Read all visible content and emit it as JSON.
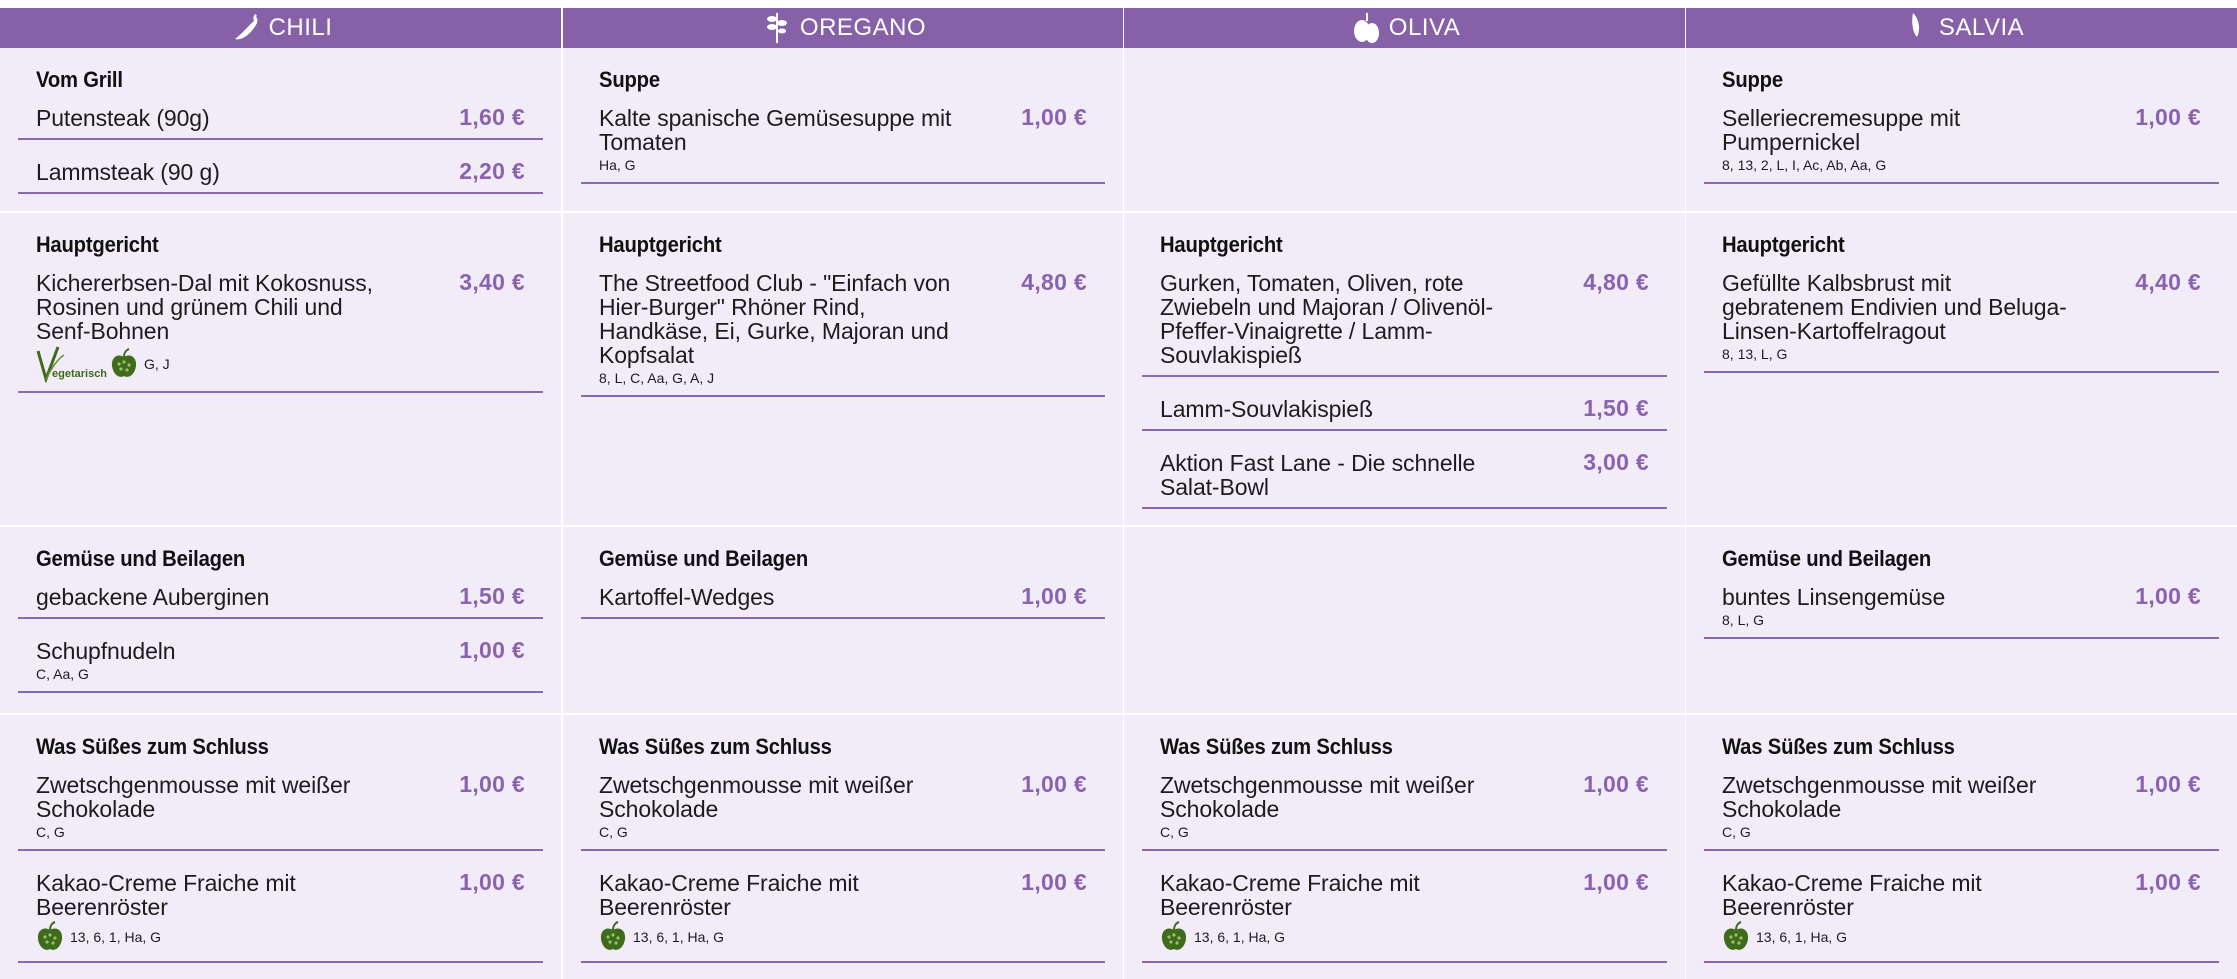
{
  "columns": [
    {
      "name": "CHILI",
      "icon": "chili-icon",
      "sections": [
        {
          "category": "Vom Grill",
          "items": [
            {
              "name": "Putensteak (90g)",
              "price": "1,60 €",
              "allergens": ""
            },
            {
              "name": "Lammsteak (90 g)",
              "price": "2,20 €",
              "allergens": ""
            }
          ]
        },
        {
          "category": "Hauptgericht",
          "items": [
            {
              "name": "Kichererbsen-Dal mit Kokosnuss, Rosinen und grünem Chili und Senf-Bohnen",
              "price": "3,40 €",
              "allergens": "G, J",
              "veg_label": "vegetarisch",
              "apple": true
            }
          ]
        },
        {
          "category": "Gemüse und Beilagen",
          "items": [
            {
              "name": "gebackene Auberginen",
              "price": "1,50 €",
              "allergens": ""
            },
            {
              "name": "Schupfnudeln",
              "price": "1,00 €",
              "allergens": "C, Aa, G"
            }
          ]
        },
        {
          "category": "Was Süßes zum Schluss",
          "items": [
            {
              "name": "Zwetschgenmousse mit weißer Schokolade",
              "price": "1,00 €",
              "allergens": "C, G"
            },
            {
              "name": "Kakao-Creme Fraiche mit Beerenröster",
              "price": "1,00 €",
              "allergens": "13, 6, 1, Ha, G",
              "apple": true
            }
          ]
        }
      ]
    },
    {
      "name": "OREGANO",
      "icon": "oregano-icon",
      "sections": [
        {
          "category": "Suppe",
          "items": [
            {
              "name": "Kalte spanische Gemüsesuppe mit Tomaten",
              "price": "1,00 €",
              "allergens": "Ha, G"
            }
          ]
        },
        {
          "category": "Hauptgericht",
          "items": [
            {
              "name": "The Streetfood Club - \"Einfach von Hier-Burger\" Rhöner Rind, Handkäse, Ei, Gurke, Majoran und Kopfsalat",
              "price": "4,80 €",
              "allergens": "8, L, C, Aa, G, A, J"
            }
          ]
        },
        {
          "category": "Gemüse und Beilagen",
          "items": [
            {
              "name": "Kartoffel-Wedges",
              "price": "1,00 €",
              "allergens": ""
            }
          ]
        },
        {
          "category": "Was Süßes zum Schluss",
          "items": [
            {
              "name": "Zwetschgenmousse mit weißer Schokolade",
              "price": "1,00 €",
              "allergens": "C, G"
            },
            {
              "name": "Kakao-Creme Fraiche mit Beerenröster",
              "price": "1,00 €",
              "allergens": "13, 6, 1, Ha, G",
              "apple": true
            }
          ]
        }
      ]
    },
    {
      "name": "OLIVA",
      "icon": "olive-icon",
      "sections": [
        {
          "category": "",
          "items": []
        },
        {
          "category": "Hauptgericht",
          "items": [
            {
              "name": "Gurken, Tomaten, Oliven, rote Zwiebeln und Majoran / Olivenöl-Pfeffer-Vinaigrette / Lamm-Souvlakispieß",
              "price": "4,80 €",
              "allergens": ""
            },
            {
              "name": "Lamm-Souvlakispieß",
              "price": "1,50 €",
              "allergens": ""
            },
            {
              "name": "Aktion Fast Lane - Die schnelle Salat-Bowl",
              "price": "3,00 €",
              "allergens": ""
            }
          ]
        },
        {
          "category": "",
          "items": []
        },
        {
          "category": "Was Süßes zum Schluss",
          "items": [
            {
              "name": "Zwetschgenmousse mit weißer Schokolade",
              "price": "1,00 €",
              "allergens": "C, G"
            },
            {
              "name": "Kakao-Creme Fraiche mit Beerenröster",
              "price": "1,00 €",
              "allergens": "13, 6, 1, Ha, G",
              "apple": true
            }
          ]
        }
      ]
    },
    {
      "name": "SALVIA",
      "icon": "sage-leaf-icon",
      "sections": [
        {
          "category": "Suppe",
          "items": [
            {
              "name": "Selleriecremesuppe mit Pumpernickel",
              "price": "1,00 €",
              "allergens": "8, 13, 2, L, I, Ac, Ab, Aa, G"
            }
          ]
        },
        {
          "category": "Hauptgericht",
          "items": [
            {
              "name": "Gefüllte Kalbsbrust mit gebratenem Endivien und Beluga-Linsen-Kartoffelragout",
              "price": "4,40 €",
              "allergens": "8, 13, L, G"
            }
          ]
        },
        {
          "category": "Gemüse und Beilagen",
          "items": [
            {
              "name": "buntes Linsengemüse",
              "price": "1,00 €",
              "allergens": "8, L, G"
            }
          ]
        },
        {
          "category": "Was Süßes zum Schluss",
          "items": [
            {
              "name": "Zwetschgenmousse mit weißer Schokolade",
              "price": "1,00 €",
              "allergens": "C, G"
            },
            {
              "name": "Kakao-Creme Fraiche mit Beerenröster",
              "price": "1,00 €",
              "allergens": "13, 6, 1, Ha, G",
              "apple": true
            }
          ]
        }
      ]
    }
  ],
  "colors": {
    "header": "#8661a8",
    "cell_bg": "#f1ecf8",
    "price": "#8a63b0",
    "rule": "#8a69ad",
    "badge_green": "#3e6b1c"
  }
}
